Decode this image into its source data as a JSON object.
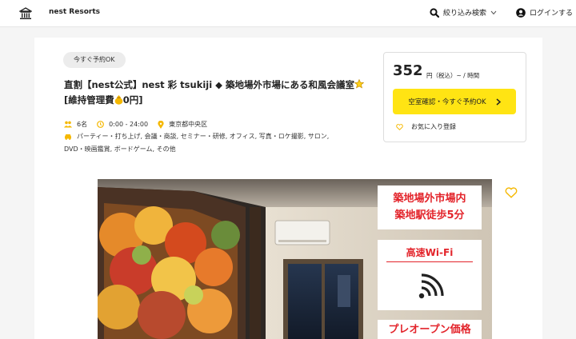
{
  "header": {
    "brand": "nest Resorts",
    "search_label": "絞り込み検索",
    "login_label": "ログインする"
  },
  "listing": {
    "badge": "今すぐ予約OK",
    "title_part1": "直割【nest公式】nest 彩 tsukiji ◆ 築地場外市場にある和風会議室",
    "title_part2": "[維持管理費",
    "title_part3": "0円]",
    "capacity": "6名",
    "hours": "0:00 - 24:00",
    "location": "東京都中央区",
    "uses_line1": "パーティー・打ち上げ, 会議・商談, セミナー・研修, オフィス, 写真・ロケ撮影, サロン,",
    "uses_line2": "DVD・映画鑑賞, ボードゲーム, その他"
  },
  "price_box": {
    "price": "352",
    "unit": "円（税込）~ / 時間",
    "reserve_label": "空室確認・今すぐ予約OK",
    "favorite_label": "お気に入り登録"
  },
  "photo": {
    "overlay1_line1": "築地場外市場内",
    "overlay1_line2": "築地駅徒歩5分",
    "overlay2": "高速Wi-Fi",
    "overlay3": "プレオープン価格"
  },
  "colors": {
    "accent": "#ffe413",
    "gold": "#f5b800",
    "overlay_red": "#e3242b"
  },
  "icons": [
    "bank-logo-icon",
    "search-icon",
    "chevron-down-icon",
    "user-circle-icon",
    "people-icon",
    "clock-icon",
    "pin-icon",
    "car-icon",
    "star-icon",
    "money-bag-icon",
    "chevron-right-icon",
    "heart-icon",
    "wifi-icon"
  ]
}
